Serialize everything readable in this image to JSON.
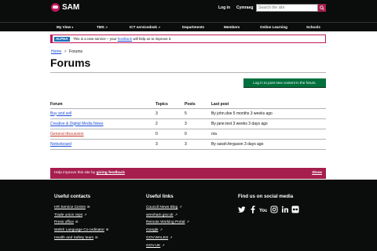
{
  "header": {
    "logo_text": "SAM",
    "login": "Log in",
    "cymraeg": "Cymraeg",
    "search_placeholder": "Search the site"
  },
  "nav": {
    "items": [
      "My View",
      "TMS",
      "ICT servicedesk",
      "Departments",
      "Members",
      "Online Learning",
      "Schools"
    ]
  },
  "alpha": {
    "tag": "ALPHA",
    "text_before": "This is a new service – your",
    "link": "feedback",
    "text_after": "will help us to improve it."
  },
  "breadcrumb": {
    "home": "Home",
    "separator": ">",
    "current": "Forums"
  },
  "page_title": "Forums",
  "login_button": "Log in to post new content in the forum.",
  "table": {
    "headers": [
      "Forum",
      "Topics",
      "Posts",
      "Last post"
    ],
    "rows": [
      {
        "forum": "Buy and sell",
        "topics": "3",
        "posts": "5",
        "last": "By john.doe 5 months 3 weeks ago"
      },
      {
        "forum": "Creative & Digital Media News",
        "topics": "2",
        "posts": "3",
        "last": "By jane.test 3 weeks 3 days ago"
      },
      {
        "forum": "General discussion",
        "topics": "0",
        "posts": "0",
        "last": "n/a"
      },
      {
        "forum": "Noticeboard",
        "topics": "3",
        "posts": "3",
        "last": "By sarah.ferguson 3 days ago"
      }
    ]
  },
  "feedback": {
    "text": "Help improve this site by",
    "link": "giving feedback",
    "show": "Show"
  },
  "footer": {
    "contacts_title": "Useful contacts",
    "contacts": [
      "HR Service Centre",
      "Trade union reps",
      "Press office",
      "Welsh Language Co-ordinator",
      "Health and Safety team"
    ],
    "links_title": "Useful links",
    "links": [
      "Council News Blog",
      "wrexham.gov.uk",
      "Remote Working Portal",
      "Google",
      "GOV.WALES",
      "GOV.UK"
    ],
    "social_title": "Find us on social media",
    "social_icons": [
      "twitter-icon",
      "facebook-icon",
      "youtube-icon",
      "instagram-icon",
      "linkedin-icon",
      "flickr-icon"
    ]
  },
  "colors": {
    "header_bg": "#0b0c0c",
    "accent": "#a61e4d",
    "button_green": "#00703c",
    "link_blue": "#1d4ed8",
    "alpha_blue": "#1d70b8"
  }
}
